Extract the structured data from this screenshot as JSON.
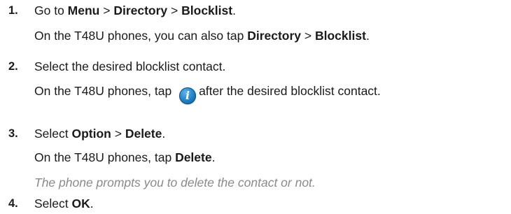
{
  "steps": [
    {
      "number": "1.",
      "lines": [
        [
          {
            "t": "Go to "
          },
          {
            "t": "Menu",
            "b": true
          },
          {
            "t": " > "
          },
          {
            "t": "Directory",
            "b": true
          },
          {
            "t": " > "
          },
          {
            "t": "Blocklist",
            "b": true
          },
          {
            "t": "."
          }
        ],
        [
          {
            "t": "On the T48U phones, you can also tap "
          },
          {
            "t": "Directory",
            "b": true
          },
          {
            "t": " > "
          },
          {
            "t": "Blocklist",
            "b": true
          },
          {
            "t": "."
          }
        ]
      ]
    },
    {
      "number": "2.",
      "lines": [
        [
          {
            "t": "Select the desired blocklist contact."
          }
        ],
        [
          {
            "t": "On the T48U phones, tap "
          },
          {
            "icon": "info-icon",
            "glyph": "i"
          },
          {
            "t": "after the desired blocklist contact."
          }
        ]
      ]
    },
    {
      "number": "3.",
      "lines": [
        [
          {
            "t": "Select "
          },
          {
            "t": "Option",
            "b": true
          },
          {
            "t": " > "
          },
          {
            "t": "Delete",
            "b": true
          },
          {
            "t": "."
          }
        ],
        [
          {
            "t": "On the T48U phones, tap "
          },
          {
            "t": "Delete",
            "b": true
          },
          {
            "t": "."
          }
        ],
        [
          {
            "t": "The phone prompts you to delete the contact or not.",
            "i": true
          }
        ]
      ]
    },
    {
      "number": "4.",
      "lines": [
        [
          {
            "t": "Select "
          },
          {
            "t": "OK",
            "b": true
          },
          {
            "t": "."
          }
        ]
      ]
    }
  ]
}
